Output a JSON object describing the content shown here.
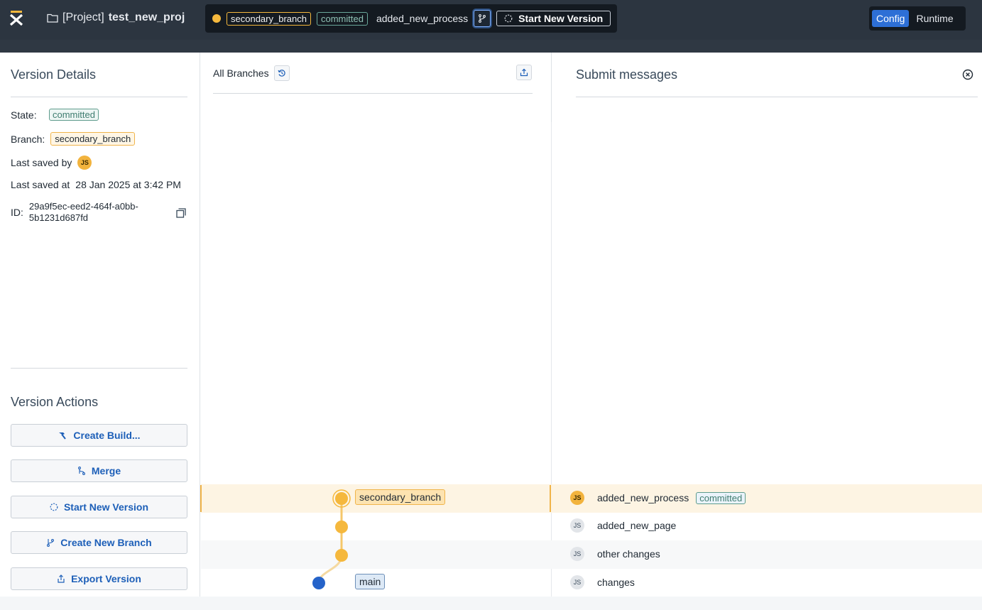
{
  "topbar": {
    "project_prefix": "[Project]",
    "project_name": "test_new_proj",
    "branch": "secondary_branch",
    "state": "committed",
    "version_name": "added_new_process",
    "start_new_version": "Start New Version",
    "mode_config": "Config",
    "mode_runtime": "Runtime"
  },
  "details": {
    "title": "Version Details",
    "state_label": "State:",
    "state_value": "committed",
    "branch_label": "Branch:",
    "branch_value": "secondary_branch",
    "saved_by_label": "Last saved by",
    "saved_by_initials": "JS",
    "saved_at_label": "Last saved at",
    "saved_at_value": "28 Jan 2025 at 3:42 PM",
    "id_label": "ID:",
    "id_value": "29a9f5ec-eed2-464f-a0bb-5b1231d687fd"
  },
  "actions": {
    "title": "Version Actions",
    "create_build": "Create Build...",
    "merge": "Merge",
    "start_new_version": "Start New Version",
    "create_new_branch": "Create New Branch",
    "export_version": "Export Version"
  },
  "graph": {
    "title": "All Branches",
    "branch_label": "secondary_branch",
    "main_label": "main"
  },
  "messages": {
    "title": "Submit messages",
    "items": [
      {
        "initials": "JS",
        "text": "added_new_process",
        "badge": "committed"
      },
      {
        "initials": "JS",
        "text": "added_new_page"
      },
      {
        "initials": "JS",
        "text": "other changes"
      },
      {
        "initials": "JS",
        "text": "changes"
      }
    ]
  },
  "colors": {
    "accent": "#2d6fd6",
    "branch": "#f5b83d",
    "main": "#2563c9",
    "committed": "#5d9b8c"
  }
}
